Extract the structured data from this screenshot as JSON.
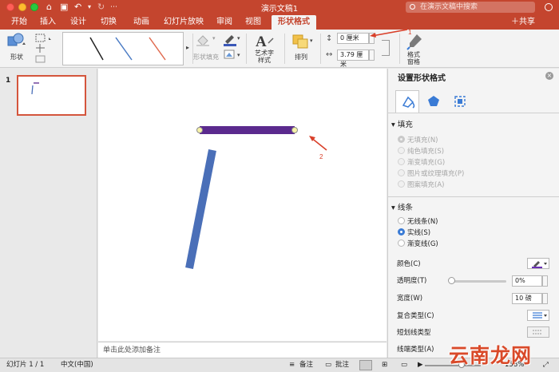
{
  "window": {
    "title": "演示文稿1",
    "search_placeholder": "在演示文稿中搜索"
  },
  "tabs": [
    "开始",
    "插入",
    "设计",
    "切换",
    "动画",
    "幻灯片放映",
    "审阅",
    "视图",
    "形状格式"
  ],
  "active_tab": "形状格式",
  "share_label": "共享",
  "ribbon": {
    "shape_label": "形状",
    "fill_label": "形状填充",
    "wordart_label": "艺术字\n样式",
    "arrange_label": "排列",
    "height_value": "0 厘米",
    "width_value": "3.79 厘米",
    "format_pane_label": "格式\n窗格",
    "style_line_colors": [
      "#222222",
      "#4a7bc4",
      "#e06a4f"
    ]
  },
  "thumbnails": {
    "slide_number": "1"
  },
  "annotations": {
    "label_1": "1",
    "label_2": "2",
    "arrow_color": "#d9402a"
  },
  "slide": {
    "notes_placeholder": "单击此处添加备注",
    "horizontal_line_color": "#5b2a8e",
    "tilted_line_color": "#4a6fb8"
  },
  "pane": {
    "title": "设置形状格式",
    "fill_section": "填充",
    "fill_options": [
      "无填充(N)",
      "纯色填充(S)",
      "渐变填充(G)",
      "图片或纹理填充(P)",
      "图案填充(A)"
    ],
    "line_section": "线条",
    "line_options": [
      "无线条(N)",
      "实线(S)",
      "渐变线(G)"
    ],
    "line_selected": "实线(S)",
    "color_label": "颜色(C)",
    "transparency_label": "透明度(T)",
    "transparency_value": "0%",
    "width_label": "宽度(W)",
    "width_value": "10 磅",
    "compound_label": "复合类型(C)",
    "dash_label": "短划线类型",
    "cap_label": "线端类型(A)",
    "accent_color": "#c4452e"
  },
  "statusbar": {
    "slide_info": "幻灯片 1 / 1",
    "language": "中文(中国)",
    "notes_btn": "备注",
    "comments_btn": "批注",
    "zoom": "158%"
  },
  "watermark": "云南龙网"
}
